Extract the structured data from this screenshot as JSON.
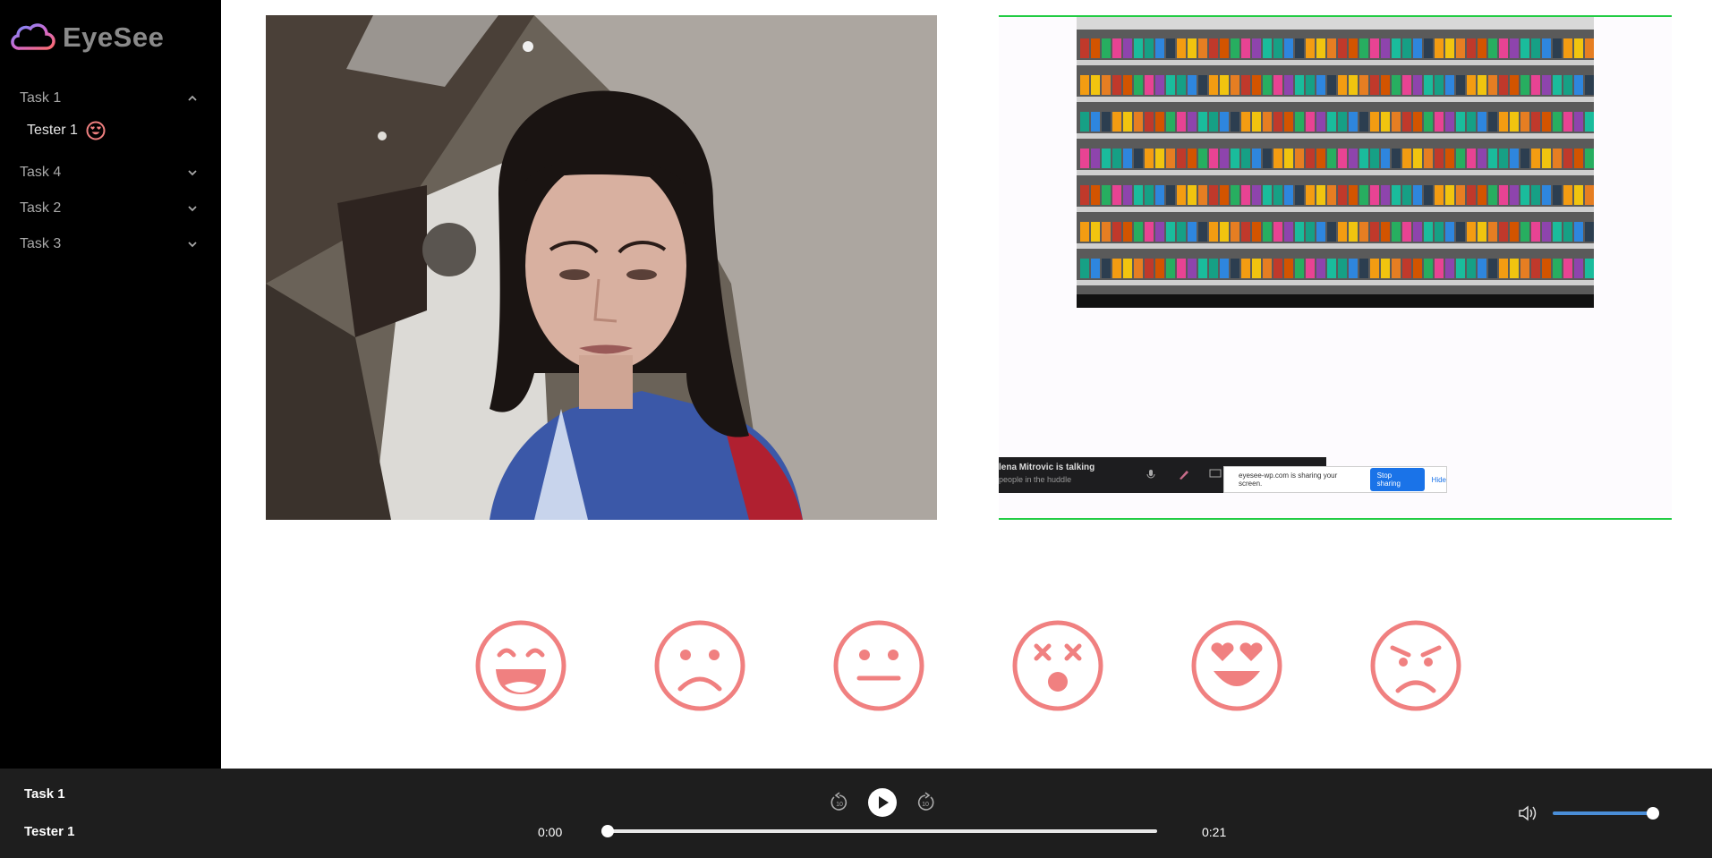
{
  "app": {
    "name": "EyeSee"
  },
  "sidebar": {
    "tasks": [
      {
        "label": "Task 1",
        "expanded": true
      },
      {
        "label": "Task 4",
        "expanded": false
      },
      {
        "label": "Task 2",
        "expanded": false
      },
      {
        "label": "Task 3",
        "expanded": false
      }
    ],
    "tester": {
      "label": "Tester 1",
      "icon": "love-face-icon"
    }
  },
  "screen_share": {
    "huddle_title": "lena Mitrovic is talking",
    "huddle_subtitle": "people in the huddle",
    "share_message": "eyesee-wp.com is sharing your screen.",
    "stop_label": "Stop sharing",
    "hide_label": "Hide"
  },
  "emotions": [
    "laughing-face-icon",
    "sad-face-icon",
    "neutral-face-icon",
    "shocked-face-icon",
    "love-face-icon",
    "angry-face-icon"
  ],
  "player": {
    "task": "Task 1",
    "tester": "Tester 1",
    "current_time": "0:00",
    "duration": "0:21",
    "progress": 0.0,
    "volume": 1.0
  },
  "colors": {
    "accent": "#f08080",
    "sidebar_bg": "#000000",
    "footer_bg": "#1e1e1e",
    "frame_border": "#22cc44",
    "volume": "#4a8ed8"
  }
}
